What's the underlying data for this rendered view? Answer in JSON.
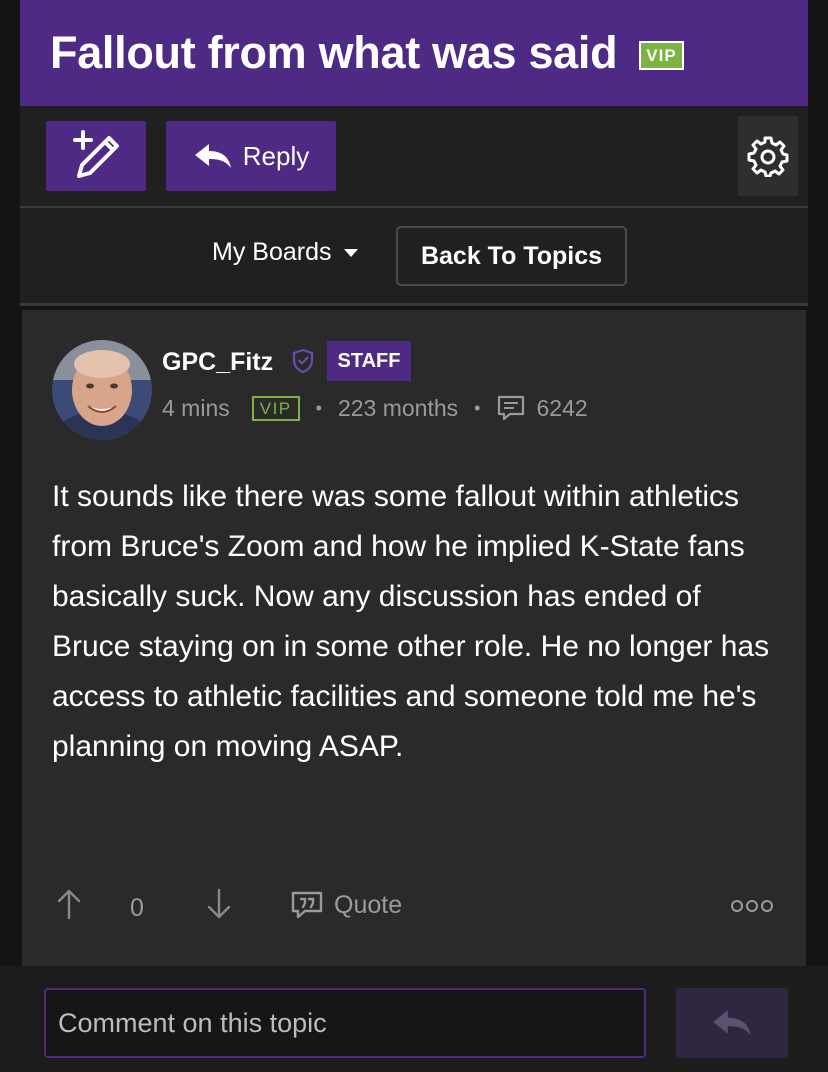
{
  "header": {
    "title": "Fallout from what was said",
    "vip_badge": "VIP"
  },
  "toolbar": {
    "new_post_icon": "compose-plus-icon",
    "reply_label": "Reply",
    "reply_icon": "reply-arrow-icon",
    "settings_icon": "gear-icon"
  },
  "nav": {
    "my_boards_label": "My Boards",
    "my_boards_icon": "caret-down-icon",
    "back_to_topics_label": "Back To Topics"
  },
  "post": {
    "author": "GPC_Fitz",
    "staff_badge": "STAFF",
    "time_ago": "4 mins",
    "vip_badge": "VIP",
    "tenure": "223 months",
    "post_count": "6242",
    "body": "It sounds like there was some fallout within athletics from Bruce's Zoom and how he implied K-State fans basically suck. Now any discussion has ended of Bruce staying on in some other role. He no longer has access to athletic facilities and someone told me he's planning on moving ASAP.",
    "vote_count": "0",
    "quote_label": "Quote"
  },
  "comment": {
    "placeholder": "Comment on this topic"
  },
  "colors": {
    "brand_purple": "#4e2a84",
    "vip_green": "#7cb342",
    "card_bg": "#2b2a2b"
  }
}
